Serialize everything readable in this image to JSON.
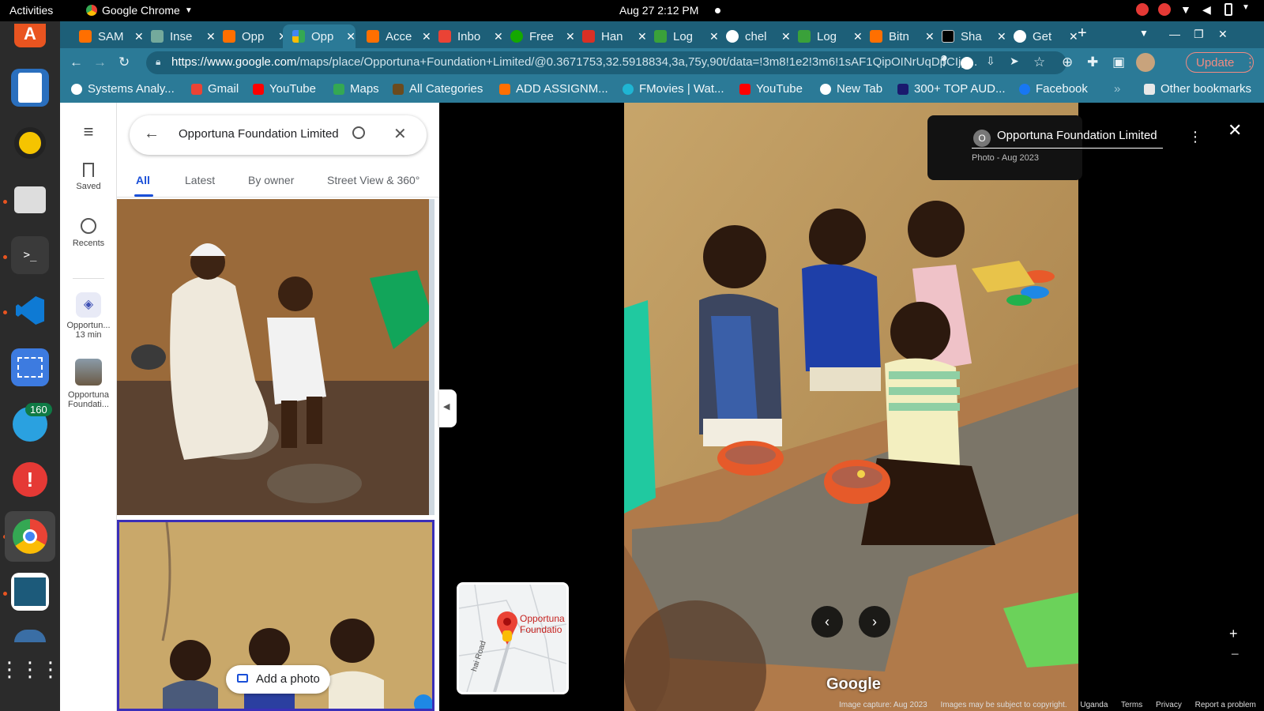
{
  "topbar": {
    "activities": "Activities",
    "app_name": "Google Chrome",
    "clock": "Aug 27  2:12 PM"
  },
  "dock": {
    "telegram_badge": "160"
  },
  "tabs": [
    {
      "title": "SAM",
      "color": "#ff6f00"
    },
    {
      "title": "Inse",
      "color": "#74aa9c"
    },
    {
      "title": "Opp",
      "color": "#ff6f00"
    },
    {
      "title": "Opp",
      "color": "#34a853"
    },
    {
      "title": "Acce",
      "color": "#ff6f00"
    },
    {
      "title": "Inbo",
      "color": "#ea4335"
    },
    {
      "title": "Free",
      "color": "#14a800"
    },
    {
      "title": "Han",
      "color": "#d93025"
    },
    {
      "title": "Log",
      "color": "#3aa13a"
    },
    {
      "title": "chel",
      "color": "#ffffff"
    },
    {
      "title": "Log",
      "color": "#3aa13a"
    },
    {
      "title": "Bitn",
      "color": "#ff6f00"
    },
    {
      "title": "Sha",
      "color": "#000000"
    },
    {
      "title": "Get",
      "color": "#ffffff"
    }
  ],
  "toolbar": {
    "url_host": "https://www.google.com",
    "url_path": "/maps/place/Opportuna+Foundation+Limited/@0.3671753,32.5918834,3a,75y,90t/data=!3m8!1e2!3m6!1sAF1QipOINrUqDpCIjp...",
    "update_label": "Update"
  },
  "bookmarks": [
    {
      "label": "Systems Analy...",
      "color": "#ffffff"
    },
    {
      "label": "Gmail",
      "color": "#ea4335"
    },
    {
      "label": "YouTube",
      "color": "#ff0000"
    },
    {
      "label": "Maps",
      "color": "#34a853"
    },
    {
      "label": "All Categories",
      "color": "#333333"
    },
    {
      "label": "ADD ASSIGNM...",
      "color": "#ff6f00"
    },
    {
      "label": "FMovies | Wat...",
      "color": "#1fb5d3"
    },
    {
      "label": "YouTube",
      "color": "#ff0000"
    },
    {
      "label": "New Tab",
      "color": "#ffffff"
    },
    {
      "label": "300+ TOP AUD...",
      "color": "#1a1a6e"
    },
    {
      "label": "Facebook",
      "color": "#1877f2"
    },
    {
      "label": "Other bookmarks",
      "color": "#e8e8e8"
    }
  ],
  "rail": {
    "saved": "Saved",
    "recents": "Recents",
    "item1_line1": "Opportun...",
    "item1_line2": "13 min",
    "item2_line1": "Opportuna",
    "item2_line2": "Foundati..."
  },
  "panel": {
    "search_value": "Opportuna Foundation Limited",
    "tabs": [
      "All",
      "Latest",
      "By owner",
      "Street View & 360°"
    ],
    "add_photo": "Add a photo"
  },
  "minimap": {
    "label_line1": "Opportuna",
    "label_line2": "Foundatio",
    "road": "hai Road"
  },
  "viewer": {
    "place_name": "Opportuna Foundation Limited",
    "avatar_letter": "O",
    "photo_meta": "Photo - Aug 2023",
    "google": "Google",
    "footer": [
      "Image capture: Aug 2023",
      "Images may be subject to copyright.",
      "Uganda",
      "Terms",
      "Privacy",
      "Report a problem"
    ]
  },
  "colors": {
    "accent": "#1a4fd8",
    "chrome_frame": "#2b7a97",
    "chrome_tabstrip": "#1d5f78",
    "update": "#f28b82"
  }
}
